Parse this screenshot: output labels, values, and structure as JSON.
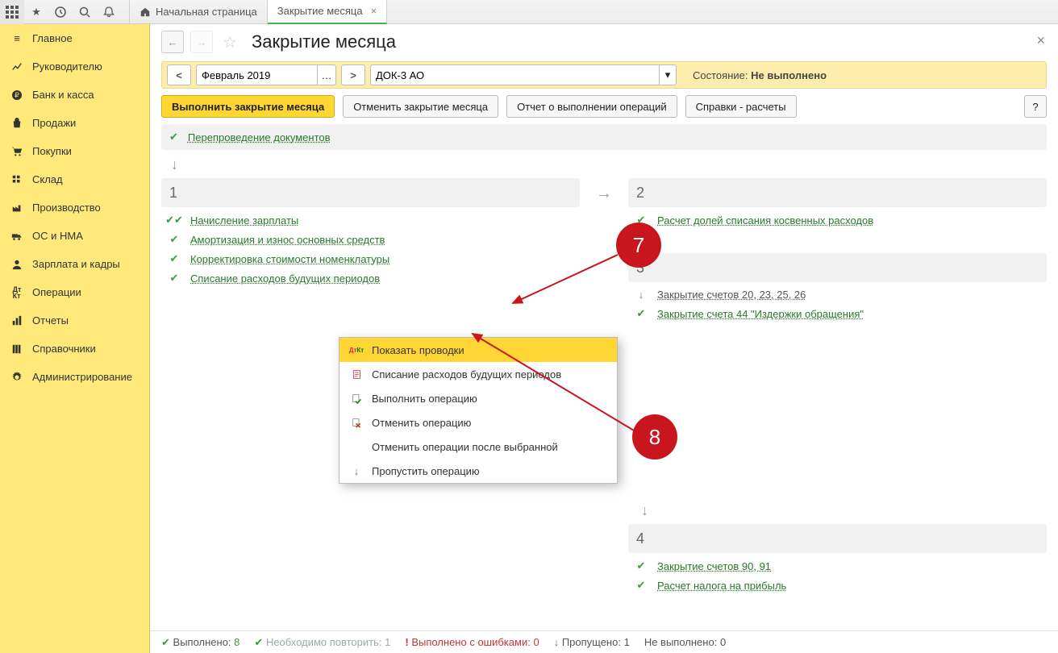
{
  "tabs": {
    "home": "Начальная страница",
    "active": "Закрытие месяца"
  },
  "sidebar": [
    "Главное",
    "Руководителю",
    "Банк и касса",
    "Продажи",
    "Покупки",
    "Склад",
    "Производство",
    "ОС и НМА",
    "Зарплата и кадры",
    "Операции",
    "Отчеты",
    "Справочники",
    "Администрирование"
  ],
  "page_title": "Закрытие месяца",
  "filter": {
    "period": "Февраль 2019",
    "org": "ДОК-3 АО",
    "state_label": "Состояние:",
    "state_value": "Не выполнено"
  },
  "buttons": {
    "run": "Выполнить закрытие месяца",
    "cancel": "Отменить закрытие месяца",
    "report": "Отчет о выполнении операций",
    "refs": "Справки - расчеты",
    "help": "?"
  },
  "top_stage": "Перепроведение документов",
  "col1": {
    "num": "1",
    "ops": [
      {
        "label": "Начисление зарплаты",
        "icon": "double-check"
      },
      {
        "label": "Амортизация и износ основных средств",
        "icon": "check"
      },
      {
        "label": "Корректировка стоимости номенклатуры",
        "icon": "check"
      },
      {
        "label": "Списание расходов будущих периодов",
        "icon": "check"
      }
    ]
  },
  "ctx": [
    "Показать проводки",
    "Списание расходов будущих периодов",
    "Выполнить операцию",
    "Отменить операцию",
    "Отменить операции после выбранной",
    "Пропустить операцию"
  ],
  "col2": {
    "s2": {
      "num": "2",
      "ops": [
        {
          "label": "Расчет долей списания косвенных расходов",
          "icon": "check"
        }
      ]
    },
    "s3": {
      "num": "3",
      "ops": [
        {
          "label": "Закрытие счетов 20, 23, 25, 26",
          "icon": "skip",
          "cls": "grey"
        },
        {
          "label": "Закрытие счета 44 \"Издержки обращения\"",
          "icon": "check"
        }
      ]
    },
    "s4": {
      "num": "4",
      "ops": [
        {
          "label": "Закрытие счетов 90, 91",
          "icon": "check"
        },
        {
          "label": "Расчет налога на прибыль",
          "icon": "check"
        }
      ]
    }
  },
  "callouts": {
    "c7": "7",
    "c8": "8"
  },
  "status": {
    "done_l": "Выполнено:",
    "done_n": "8",
    "rep_l": "Необходимо повторить:",
    "rep_n": "1",
    "err_l": "Выполнено с ошибками:",
    "err_n": "0",
    "skip_l": "Пропущено:",
    "skip_n": "1",
    "nd_l": "Не выполнено:",
    "nd_n": "0"
  }
}
